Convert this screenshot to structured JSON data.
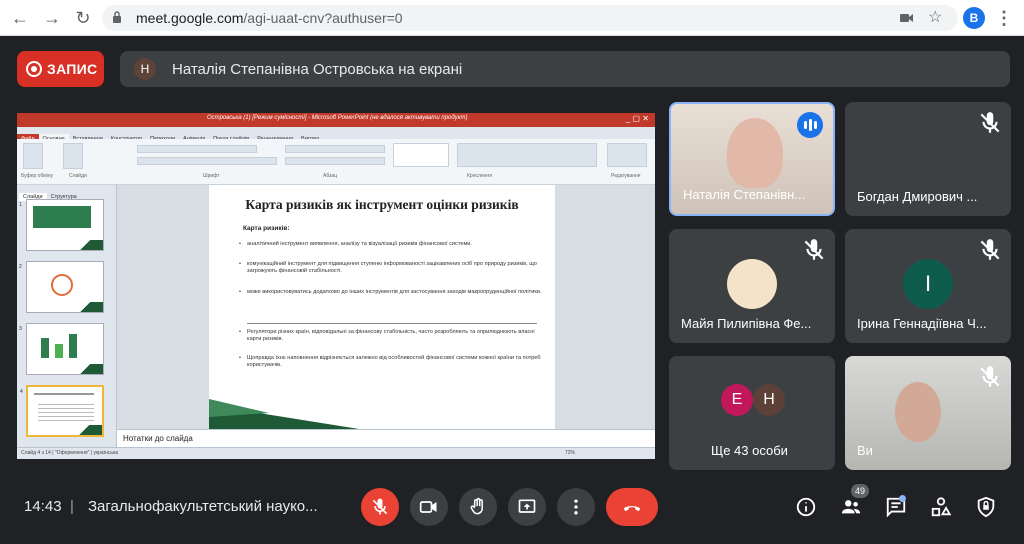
{
  "browser": {
    "url_host": "meet.google.com",
    "url_path": "/agi-uaat-cnv?authuser=0",
    "profile_initial": "B"
  },
  "recording": {
    "label": "ЗАПИС"
  },
  "presenter": {
    "initial": "Н",
    "label": "Наталія Степанівна Островська на екрані"
  },
  "presentation": {
    "window_title": "Островська (1) [Режим сумісності] - Microsoft PowerPoint (не вдалося активувати продукт)",
    "tabs": [
      "Файл",
      "Основне",
      "Вставлення",
      "Конструктор",
      "Переходи",
      "Анімація",
      "Показ слайдів",
      "Рецензування",
      "Вигляд"
    ],
    "groups": [
      "Буфер обміну",
      "Слайди",
      "Шрифт",
      "Абзац",
      "Креслення",
      "Редагування"
    ],
    "pane_tabs": [
      "Слайди",
      "Структура"
    ],
    "slide": {
      "title": "Карта ризиків як інструмент оцінки ризиків",
      "subtitle": "Карта ризиків:",
      "bullets": [
        "аналітичний інструмент виявлення, аналізу та візуалізації ризиків фінансової системи.",
        "комунікаційний інструмент для підвищення ступеню інформованості зацікавлених осіб про природу ризиків, що загрожують фінансовій стабільності.",
        "може використовуватись додатково до інших інструментів для застосування заходів макропруденційної політики.",
        "Регулятори різних країн, відповідальні за фінансову стабільність, часто розробляють та оприлюднюють власні карти ризиків.",
        "Щоправда їхнє наповнення відрізняється залежно від особливостей фінансової системи кожної країни та потреб користувачів."
      ]
    },
    "notes": "Нотатки до слайда",
    "status": "Слайд 4 з 14 | \"Оформлення\" | українська",
    "zoom": "72%"
  },
  "participants": [
    {
      "name": "Наталія Степанівн...",
      "speaking": true
    },
    {
      "name": "Богдан Дмирович ...",
      "muted": true
    },
    {
      "name": "Майя Пилипівна Фе...",
      "muted": true
    },
    {
      "name": "Ірина Геннадіївна Ч...",
      "muted": true,
      "initial": "І",
      "color": "#0d5c4e"
    },
    {
      "name": "Ще 43 особи",
      "initials": [
        "Е",
        "Н"
      ],
      "colors": [
        "#c2185b",
        "#5d4037"
      ]
    },
    {
      "name": "Ви",
      "muted": true
    }
  ],
  "bottom": {
    "time": "14:43",
    "meeting_title": "Загальнофакультетський науко...",
    "people_count": "49"
  }
}
